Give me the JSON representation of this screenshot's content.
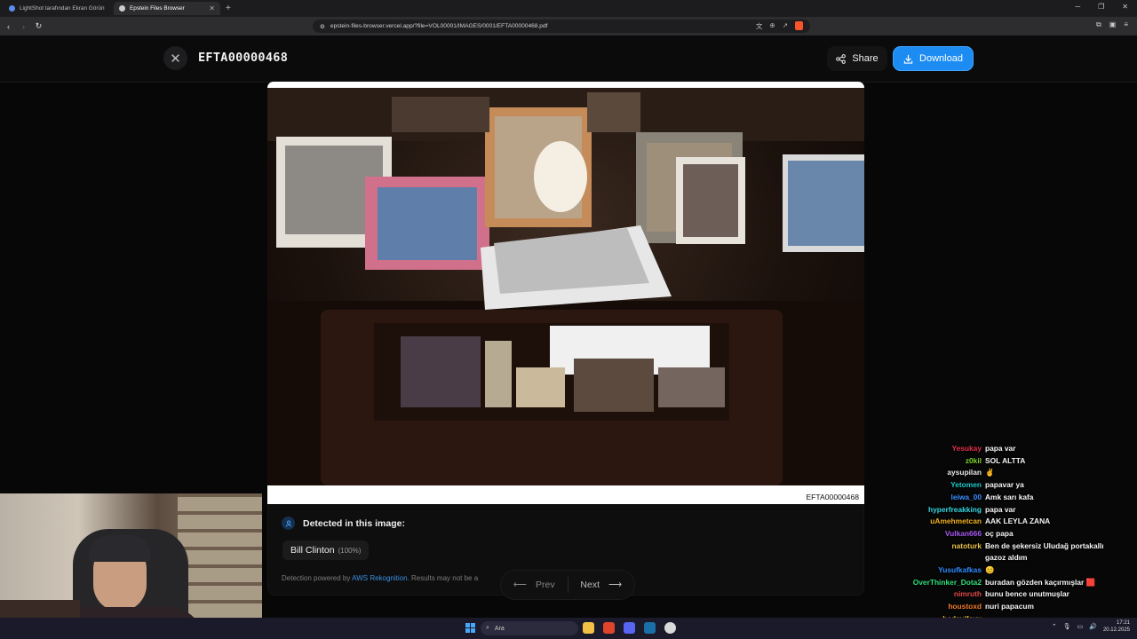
{
  "browser": {
    "tabs": [
      {
        "title": "LightShot tarafından Ekran Görüntüs",
        "active": false
      },
      {
        "title": "Epstein Files Browser",
        "active": true
      }
    ],
    "url": "epstein-files-browser.vercel.app/?file=VOL00001/IMAGES/0001/EFTA00000468.pdf"
  },
  "viewer": {
    "title": "EFTA00000468",
    "share_label": "Share",
    "download_label": "Download",
    "stamp": "EFTA00000468",
    "accent": "#1c8cf2"
  },
  "detection": {
    "title": "Detected in this image:",
    "people": [
      {
        "name": "Bill Clinton",
        "confidence": "(100%)"
      }
    ],
    "footer_prefix": "Detection powered by ",
    "footer_link": "AWS Rekognition",
    "footer_suffix": ". Results may not be a"
  },
  "pager": {
    "prev_label": "Prev",
    "next_label": "Next"
  },
  "chat": [
    {
      "user": "Yesukay",
      "msg": "papa var",
      "color": "#e0304a"
    },
    {
      "user": "z0kil",
      "msg": "SOL ALTTA",
      "color": "#7bd12b"
    },
    {
      "user": "aysupilan",
      "msg": "✌",
      "color": "#e8e8e8"
    },
    {
      "user": "Yetomen",
      "msg": "papavar ya",
      "color": "#1ec8c8"
    },
    {
      "user": "leiwa_00",
      "msg": "Amk sarı kafa",
      "color": "#3a8fff"
    },
    {
      "user": "hyperfreakking",
      "msg": "papa var",
      "color": "#35d6e0"
    },
    {
      "user": "uAmehmetcan",
      "msg": "AAK LEYLA ZANA",
      "color": "#f0b020"
    },
    {
      "user": "Vulkan666",
      "msg": "oç papa",
      "color": "#a858f0"
    },
    {
      "user": "natoturk",
      "msg": "Ben de şekersiz Uludağ portakallı gazoz aldım",
      "color": "#e8c24a"
    },
    {
      "user": "Yusufkafkas",
      "msg": "😊",
      "color": "#2f8bff"
    },
    {
      "user": "OverThinker_Dota2",
      "msg": "buradan gözden kaçırmışlar 🟥",
      "color": "#2ee07a"
    },
    {
      "user": "nimruth",
      "msg": "bunu bence unutmuşlar",
      "color": "#e24a4a"
    },
    {
      "user": "houstoxd",
      "msg": "nuri papacum",
      "color": "#f07a2a"
    },
    {
      "user": "bedevifoxy",
      "msg": "",
      "color": "#f0c030"
    }
  ],
  "taskbar": {
    "search_placeholder": "Ara",
    "time": "17:21",
    "date": "20.12.2025"
  }
}
